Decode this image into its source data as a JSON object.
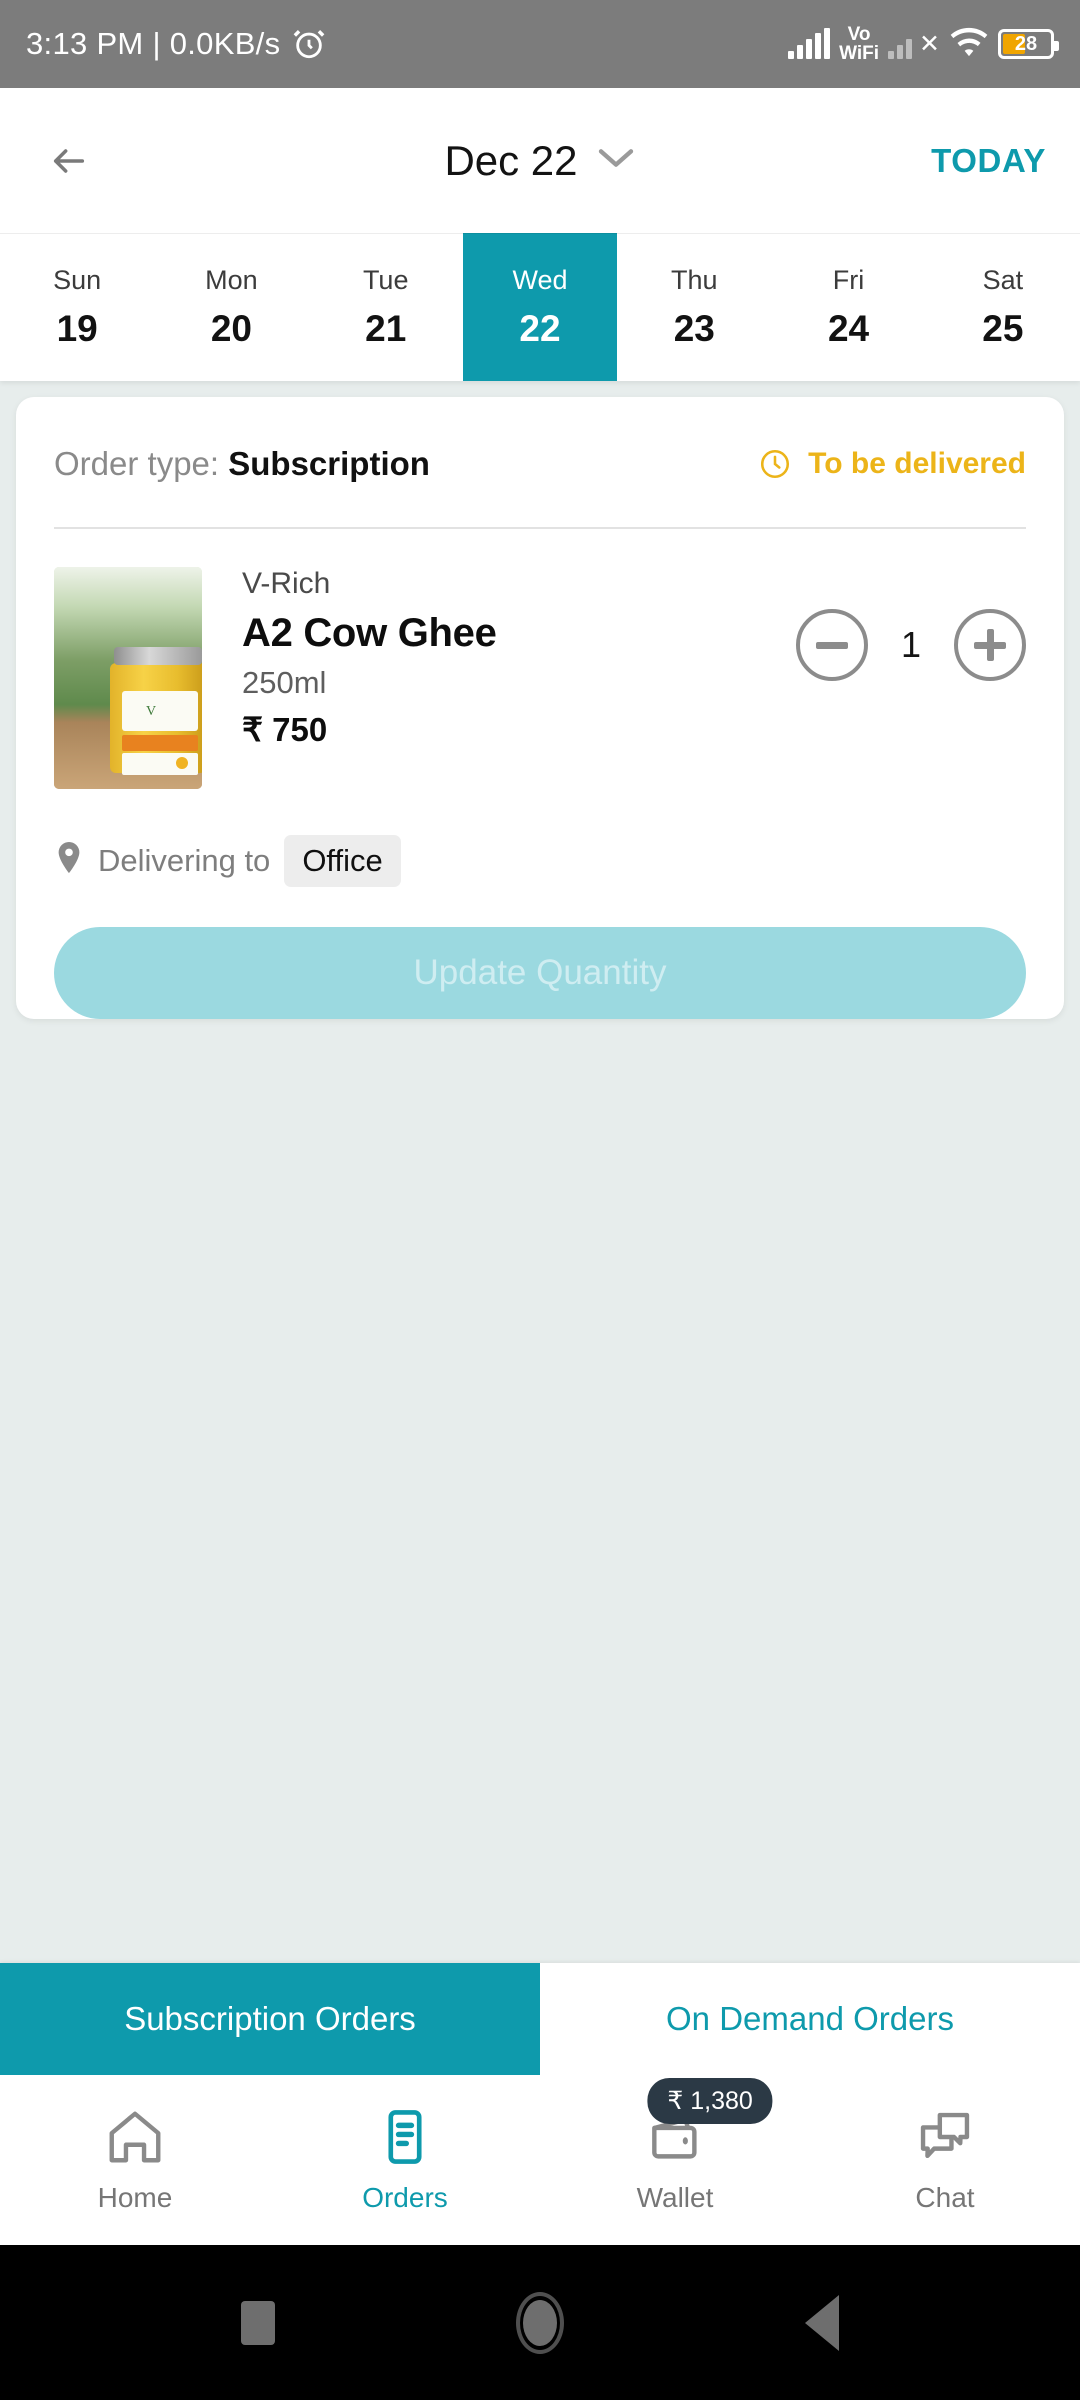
{
  "status_bar": {
    "time_and_speed": "3:13 PM | 0.0KB/s",
    "alarm_icon": "alarm-icon",
    "network_label": "Vo",
    "network_label2": "WiFi",
    "sim2_x": "✕",
    "battery_percent": "28"
  },
  "header": {
    "back_icon": "back-arrow-icon",
    "title": "Dec 22",
    "chevron_icon": "chevron-down-icon",
    "today_label": "TODAY"
  },
  "week_strip": {
    "days": [
      {
        "dow": "Sun",
        "num": "19",
        "active": false
      },
      {
        "dow": "Mon",
        "num": "20",
        "active": false
      },
      {
        "dow": "Tue",
        "num": "21",
        "active": false
      },
      {
        "dow": "Wed",
        "num": "22",
        "active": true
      },
      {
        "dow": "Thu",
        "num": "23",
        "active": false
      },
      {
        "dow": "Fri",
        "num": "24",
        "active": false
      },
      {
        "dow": "Sat",
        "num": "25",
        "active": false
      }
    ]
  },
  "order_card": {
    "order_type_label": "Order type:",
    "order_type_value": "Subscription",
    "status_icon": "clock-icon",
    "status_text": "To be delivered",
    "product": {
      "image_alt": "a2-cow-ghee-jar-image",
      "brand": "V-Rich",
      "name": "A2 Cow Ghee",
      "size": "250ml",
      "price": "₹ 750",
      "quantity": "1",
      "decrease_icon": "minus-circle-icon",
      "increase_icon": "plus-circle-icon"
    },
    "delivery": {
      "pin_icon": "location-pin-icon",
      "label": "Delivering to",
      "address_chip": "Office"
    },
    "update_button_label": "Update Quantity"
  },
  "order_tabs": [
    {
      "label": "Subscription Orders",
      "active": true
    },
    {
      "label": "On Demand Orders",
      "active": false
    }
  ],
  "bottom_nav": {
    "items": [
      {
        "label": "Home",
        "icon": "home-icon",
        "active": false,
        "badge": null
      },
      {
        "label": "Orders",
        "icon": "orders-document-icon",
        "active": true,
        "badge": null
      },
      {
        "label": "Wallet",
        "icon": "wallet-icon",
        "active": false,
        "badge": "₹ 1,380"
      },
      {
        "label": "Chat",
        "icon": "chat-bubbles-icon",
        "active": false,
        "badge": null
      }
    ]
  },
  "system_nav": {
    "recents_icon": "square-recents-icon",
    "home_icon": "circle-home-icon",
    "back_icon": "triangle-back-icon"
  },
  "colors": {
    "accent_teal": "#0E9AAC",
    "status_amber": "#ECB419",
    "page_bg": "#E7EDEC",
    "badge_dark": "#2B3945",
    "disabled_button": "#9BD9E0"
  }
}
